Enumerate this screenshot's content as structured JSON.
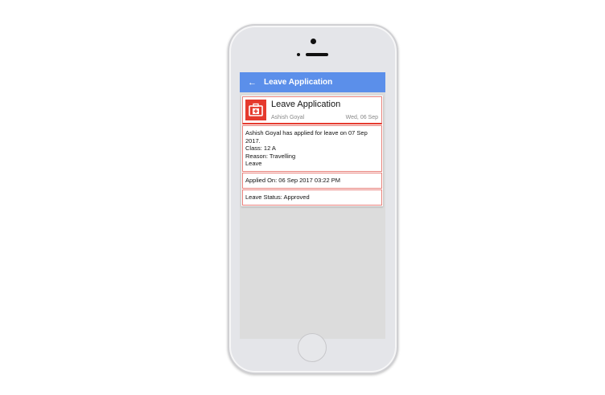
{
  "appbar": {
    "title": "Leave Application",
    "back_icon": "arrow-left-icon"
  },
  "card": {
    "title": "Leave Application",
    "name": "Ashish Goyal",
    "date": "Wed, 06 Sep",
    "message_line1": "Ashish Goyal has applied for leave on 07 Sep 2017.",
    "class": "Class: 12 A",
    "reason": "Reason: Travelling",
    "type": "Leave",
    "applied_on": "Applied On: 06 Sep 2017 03:22 PM",
    "status": "Leave Status: Approved"
  },
  "colors": {
    "appbar": "#5b8fea",
    "accent": "#e53a2e"
  }
}
